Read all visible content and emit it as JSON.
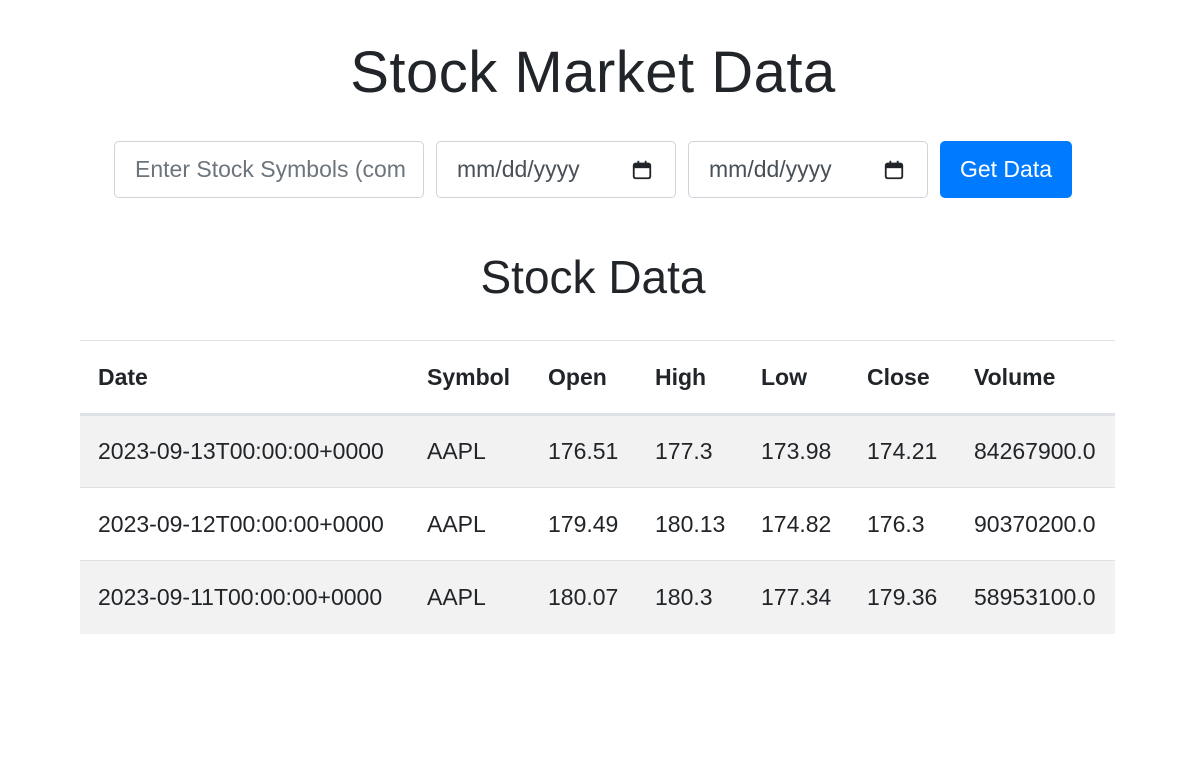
{
  "page": {
    "title": "Stock Market Data",
    "section_title": "Stock Data"
  },
  "form": {
    "symbols": {
      "placeholder": "Enter Stock Symbols (com",
      "value": ""
    },
    "start_date": {
      "placeholder": "mm/dd/yyyy",
      "icon": "calendar-icon"
    },
    "end_date": {
      "placeholder": "mm/dd/yyyy",
      "icon": "calendar-icon"
    },
    "submit_label": "Get Data"
  },
  "table": {
    "headers": [
      "Date",
      "Symbol",
      "Open",
      "High",
      "Low",
      "Close",
      "Volume"
    ],
    "rows": [
      [
        "2023-09-13T00:00:00+0000",
        "AAPL",
        "176.51",
        "177.3",
        "173.98",
        "174.21",
        "84267900.0"
      ],
      [
        "2023-09-12T00:00:00+0000",
        "AAPL",
        "179.49",
        "180.13",
        "174.82",
        "176.3",
        "90370200.0"
      ],
      [
        "2023-09-11T00:00:00+0000",
        "AAPL",
        "180.07",
        "180.3",
        "177.34",
        "179.36",
        "58953100.0"
      ]
    ]
  },
  "colors": {
    "primary": "#007bff",
    "text": "#212529",
    "stripe": "#f2f2f2",
    "border": "#dee2e6"
  }
}
